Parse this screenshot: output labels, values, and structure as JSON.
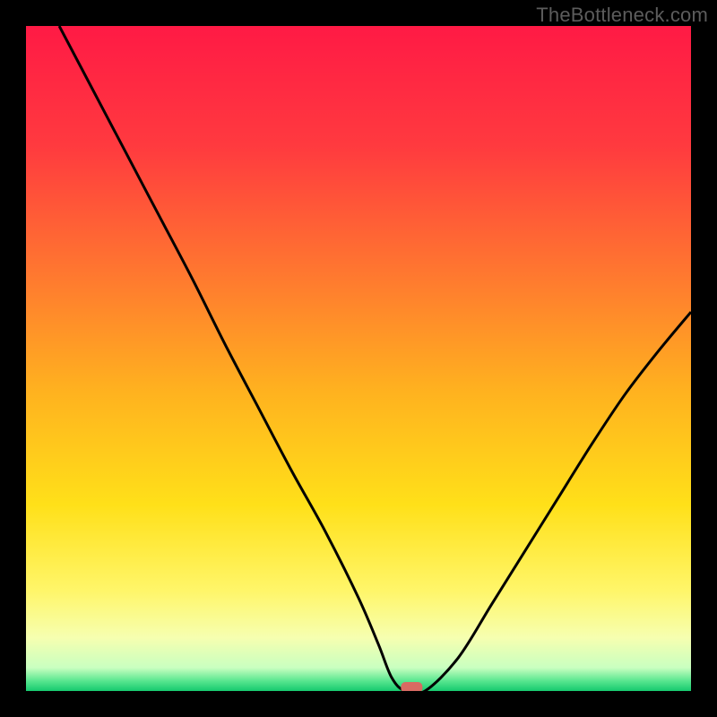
{
  "watermark": "TheBottleneck.com",
  "colors": {
    "gradient_stops": [
      {
        "offset": 0.0,
        "color": "#ff1a45"
      },
      {
        "offset": 0.18,
        "color": "#ff3a3f"
      },
      {
        "offset": 0.38,
        "color": "#ff7a2f"
      },
      {
        "offset": 0.55,
        "color": "#ffb21f"
      },
      {
        "offset": 0.72,
        "color": "#ffe019"
      },
      {
        "offset": 0.85,
        "color": "#fff66a"
      },
      {
        "offset": 0.92,
        "color": "#f6ffb0"
      },
      {
        "offset": 0.965,
        "color": "#c9ffc0"
      },
      {
        "offset": 0.985,
        "color": "#57e68f"
      },
      {
        "offset": 1.0,
        "color": "#16c96e"
      }
    ],
    "curve": "#000000",
    "marker": "#d86a62",
    "frame": "#000000"
  },
  "chart_data": {
    "type": "line",
    "title": "",
    "xlabel": "",
    "ylabel": "",
    "xlim": [
      0,
      100
    ],
    "ylim": [
      0,
      100
    ],
    "series": [
      {
        "name": "bottleneck-curve",
        "x": [
          5,
          10,
          15,
          20,
          25,
          30,
          35,
          40,
          45,
          50,
          53,
          55,
          57,
          60,
          65,
          70,
          75,
          80,
          85,
          90,
          95,
          100
        ],
        "y": [
          100,
          90.5,
          81,
          71.5,
          62,
          52,
          42.5,
          33,
          24,
          14,
          7,
          2,
          0,
          0,
          5,
          13,
          21,
          29,
          37,
          44.5,
          51,
          57
        ]
      }
    ],
    "flat_region": {
      "x_start": 55,
      "x_end": 61,
      "y": 0
    },
    "marker": {
      "x": 58,
      "y": 0,
      "shape": "rounded-rect"
    }
  }
}
